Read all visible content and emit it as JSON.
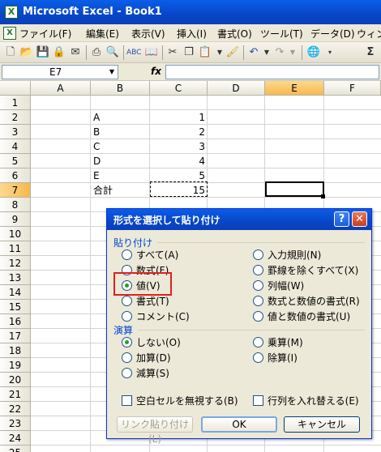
{
  "window": {
    "title": "Microsoft Excel - Book1",
    "app_icon_glyph": "X"
  },
  "menu": [
    "ファイル(F)",
    "編集(E)",
    "表示(V)",
    "挿入(I)",
    "書式(O)",
    "ツール(T)",
    "データ(D)",
    "ウィン"
  ],
  "toolbar": {
    "icons": [
      "new-icon",
      "open-icon",
      "save-icon",
      "permission-icon",
      "email-icon",
      "print-icon",
      "print-preview-icon",
      "spelling-icon",
      "research-icon",
      "cut-icon",
      "copy-icon",
      "paste-icon",
      "format-painter-icon",
      "undo-icon",
      "redo-icon",
      "hyperlink-icon",
      "autosum-icon"
    ],
    "autosum_glyph": "Σ"
  },
  "formula_bar": {
    "name_box": "E7",
    "fx_label": "fx",
    "formula": ""
  },
  "columns": [
    "A",
    "B",
    "C",
    "D",
    "E",
    "F"
  ],
  "selected_column": "E",
  "rows": [
    "1",
    "2",
    "3",
    "4",
    "5",
    "6",
    "7",
    "8",
    "9",
    "10",
    "11",
    "12",
    "13",
    "14",
    "15",
    "16",
    "17",
    "18",
    "19",
    "20",
    "21",
    "22",
    "23",
    "24",
    "25"
  ],
  "selected_row": "7",
  "cells": {
    "B2": "A",
    "C2": "1",
    "B3": "B",
    "C3": "2",
    "B4": "C",
    "C4": "3",
    "B5": "D",
    "C5": "4",
    "B6": "E",
    "C6": "5",
    "B7": "合計",
    "C7": "15"
  },
  "dialog": {
    "title": "形式を選択して貼り付け",
    "help_glyph": "?",
    "close_glyph": "✕",
    "paste_group": "貼り付け",
    "paste_options_left": [
      "すべて(A)",
      "数式(F)",
      "値(V)",
      "書式(T)",
      "コメント(C)"
    ],
    "paste_options_right": [
      "入力規則(N)",
      "罫線を除くすべて(X)",
      "列幅(W)",
      "数式と数値の書式(R)",
      "値と数値の書式(U)"
    ],
    "paste_selected": "値(V)",
    "operation_group": "演算",
    "operation_left": [
      "しない(O)",
      "加算(D)",
      "減算(S)"
    ],
    "operation_right": [
      "乗算(M)",
      "除算(I)"
    ],
    "operation_selected": "しない(O)",
    "skip_blanks": "空白セルを無視する(B)",
    "transpose": "行列を入れ替える(E)",
    "paste_link_button": "リンク貼り付け(L)",
    "ok_button": "OK",
    "cancel_button": "キャンセル"
  }
}
